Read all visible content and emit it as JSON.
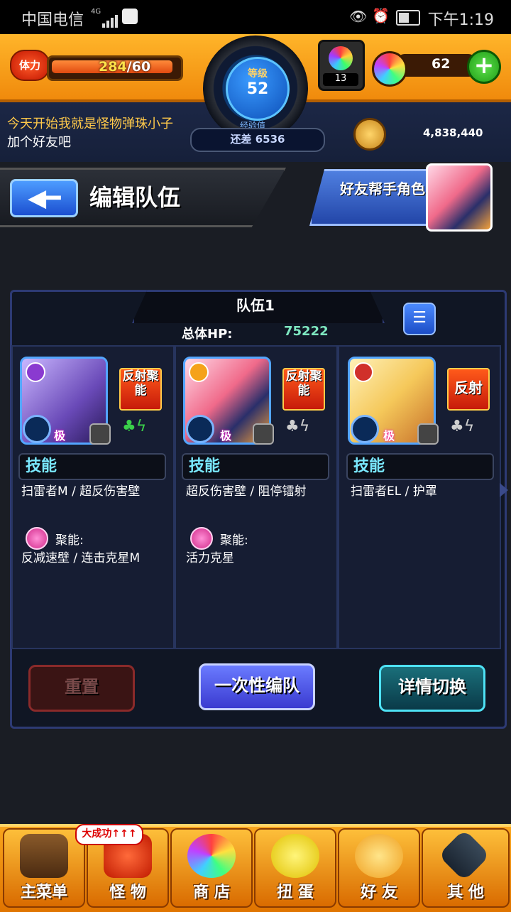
{
  "status_bar": {
    "carrier": "中国电信",
    "network": "4G",
    "time": "下午1:19"
  },
  "header": {
    "stamina_label": "体力",
    "stamina_current": "284",
    "stamina_max": "/60",
    "level_label": "等级",
    "level": "52",
    "exp_label": "经验值",
    "exp_remaining": "还差 6536",
    "orb_count": "13",
    "gem_count": "62",
    "coin_amount": "4,838,440",
    "marquee_line1": "今天开始我就是怪物弹珠小子",
    "marquee_line2": "加个好友吧"
  },
  "title_bar": {
    "title": "编辑队伍",
    "helper_label": "好友帮手角色"
  },
  "team": {
    "name": "队伍1",
    "total_hp_label": "总体HP:",
    "total_hp": "75222",
    "members": [
      {
        "rank": "极",
        "ability": "反射聚能",
        "skill_header": "技能",
        "skills": "扫雷者M / 超反伤害壁",
        "ss_label": "聚能:",
        "ss_skills": "反减速壁 / 连击克星M",
        "portrait_color": "#8a6ad8"
      },
      {
        "rank": "极",
        "ability": "反射聚能",
        "skill_header": "技能",
        "skills": "超反伤害壁 / 阻停镭射",
        "ss_label": "聚能:",
        "ss_skills": "活力克星",
        "portrait_color": "#f07a9a"
      },
      {
        "rank": "极",
        "ability": "反射",
        "skill_header": "技能",
        "skills": "扫雷者EL / 护罩",
        "ss_label": "",
        "ss_skills": "",
        "portrait_color": "#f5c85a"
      }
    ]
  },
  "actions": {
    "reset": "重置",
    "one_time": "一次性编队",
    "detail_switch": "详情切换"
  },
  "nav": {
    "success_badge": "大成功↑↑↑",
    "items": [
      {
        "label": "主菜单",
        "icon": "castle-icon"
      },
      {
        "label": "怪 物",
        "icon": "monster-icon"
      },
      {
        "label": "商 店",
        "icon": "orb-icon"
      },
      {
        "label": "扭 蛋",
        "icon": "egg-icon"
      },
      {
        "label": "好 友",
        "icon": "friends-icon"
      },
      {
        "label": "其 他",
        "icon": "other-icon"
      }
    ]
  }
}
